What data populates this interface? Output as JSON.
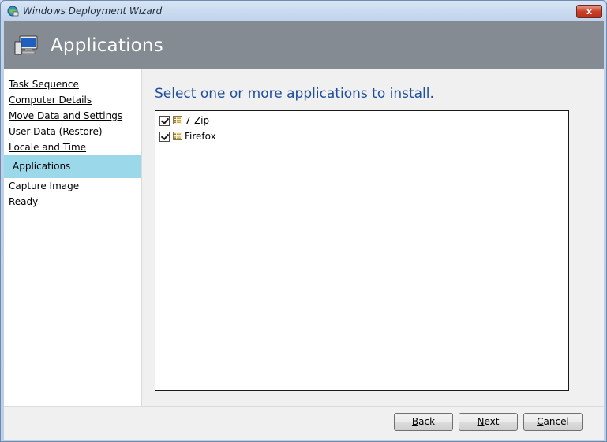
{
  "window": {
    "title": "Windows Deployment Wizard",
    "close_label": "x"
  },
  "header": {
    "title": "Applications"
  },
  "sidebar": {
    "items": [
      {
        "label": "Task Sequence",
        "state": "link"
      },
      {
        "label": "Computer Details",
        "state": "link"
      },
      {
        "label": "Move Data and Settings",
        "state": "link"
      },
      {
        "label": "User Data (Restore)",
        "state": "link"
      },
      {
        "label": "Locale and Time",
        "state": "link"
      },
      {
        "label": "Applications",
        "state": "current"
      },
      {
        "label": "Capture Image",
        "state": "pending"
      },
      {
        "label": "Ready",
        "state": "pending"
      }
    ]
  },
  "main": {
    "instruction": "Select one or more applications to install.",
    "applications": [
      {
        "name": "7-Zip",
        "checked": true
      },
      {
        "name": "Firefox",
        "checked": true
      }
    ]
  },
  "footer": {
    "back": {
      "first": "B",
      "rest": "ack"
    },
    "next": {
      "first": "N",
      "rest": "ext"
    },
    "cancel": {
      "first": "C",
      "rest": "ancel"
    }
  },
  "colors": {
    "header_bg": "#858b92",
    "selected_nav_bg": "#9bd8e9",
    "instruction_text": "#1e4e9c"
  }
}
